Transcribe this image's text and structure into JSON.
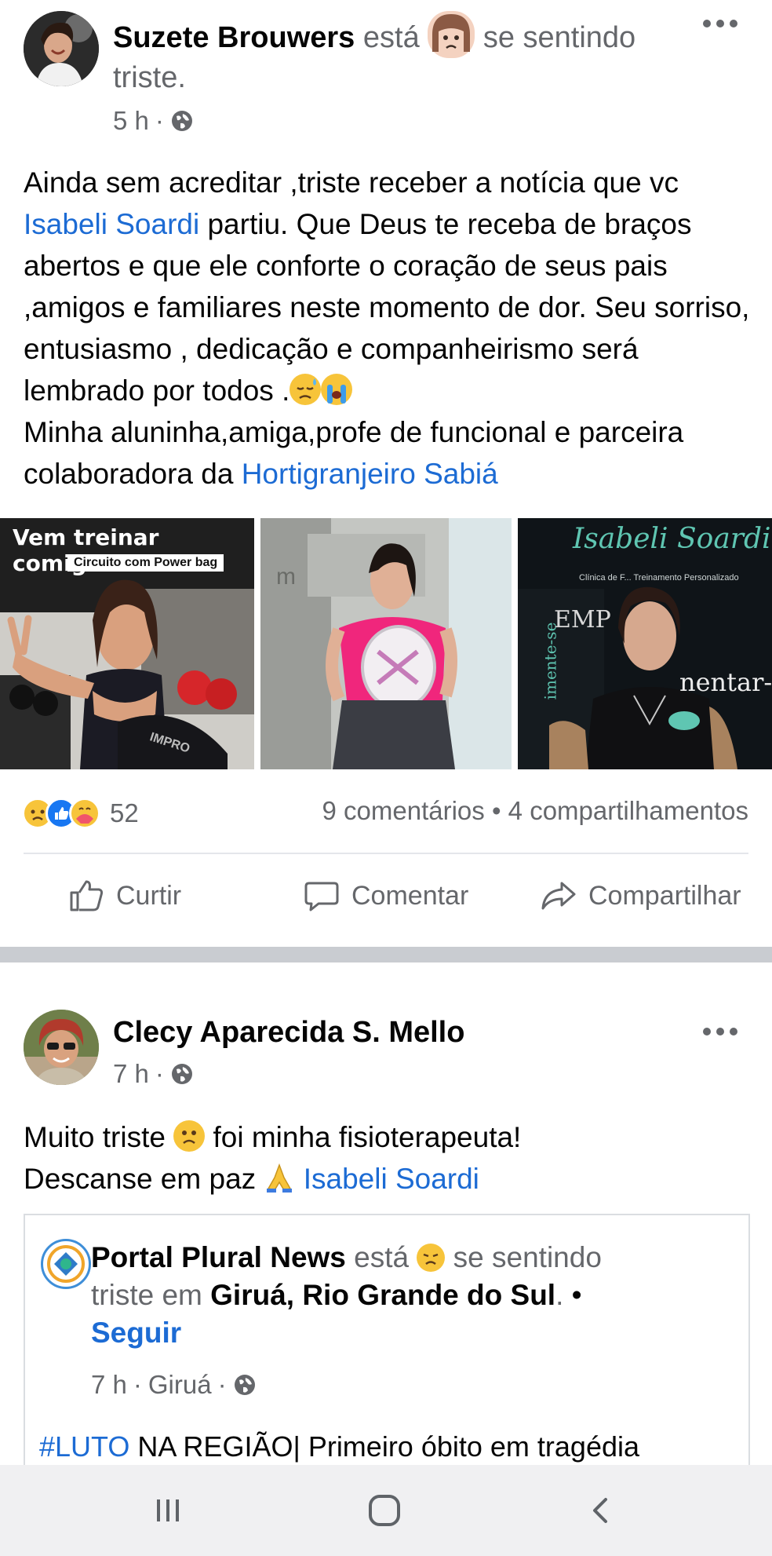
{
  "post1": {
    "author": "Suzete Brouwers",
    "verb": "está",
    "feeling": "se sentindo",
    "feeling_word": "triste.",
    "time": "5 h",
    "meta_sep": "·",
    "text": {
      "p1": "Ainda sem acreditar ,triste receber a notícia que vc",
      "mention1": "Isabeli Soardi",
      "p2": "partiu. Que Deus te receba de braços abertos e que ele conforte o coração de seus pais ,amigos e familiares neste momento de dor.  Seu sorriso, entusiasmo , dedicação e companheirismo será lembrado por todos .",
      "p3": "Minha aluninha,amiga,profe  de funcional e parceira colaboradora da",
      "mention2": "Hortigranjeiro Sabiá"
    },
    "photos": {
      "photo1_title": "Vem treinar comigo",
      "photo1_badge": "Circuito com Power bag",
      "photo1_bag": "IMPRO",
      "photo3_sign": "Isabeli Soardi",
      "photo3_sub": "Clínica de F... Treinamento Personalizado",
      "photo3_side": "imente-se",
      "photo3_wall1": "EMP",
      "photo3_wall2": "nentar-",
      "photo2_wall": "m"
    },
    "reactions_count": "52",
    "comments": "9 comentários",
    "dot": "•",
    "shares": "4 compartilhamentos",
    "actions": {
      "like": "Curtir",
      "comment": "Comentar",
      "share": "Compartilhar"
    }
  },
  "post2": {
    "author": "Clecy Aparecida S. Mello",
    "time": "7 h",
    "meta_sep": "·",
    "text": {
      "l1a": "Muito triste",
      "l1b": "foi minha fisioterapeuta!",
      "l2a": "Descanse em paz",
      "mention": "Isabeli Soardi"
    },
    "shared": {
      "page": "Portal Plural News",
      "verb": "está",
      "feeling": "se sentindo",
      "feeling_word": "triste em",
      "location": "Giruá, Rio Grande do Sul",
      "period": ".",
      "bullet": "•",
      "follow": "Seguir",
      "time": "7 h",
      "place": "Giruá",
      "sep": "·",
      "hashtag": "#LUTO",
      "headline": "NA REGIÃO| Primeiro óbito em tragédia"
    }
  },
  "colors": {
    "link": "#1c6bd4",
    "secondary_text": "#65676b",
    "separator": "#c9ccd1",
    "pink_shirt": "#f0267c"
  }
}
